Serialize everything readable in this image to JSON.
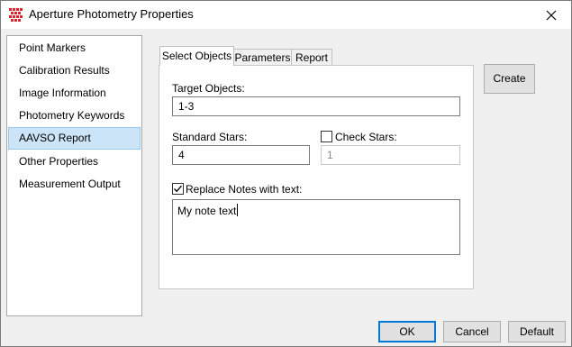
{
  "window": {
    "title": "Aperture Photometry Properties"
  },
  "icons": {
    "app": "grid-app-icon",
    "close": "close-icon",
    "checkmark": "checkmark-icon"
  },
  "colors": {
    "accent": "#0078d7",
    "selection": "#cce4f7",
    "app_icon": "#d9232e"
  },
  "sidebar": {
    "items": [
      {
        "label": "Point Markers"
      },
      {
        "label": "Calibration Results"
      },
      {
        "label": "Image Information"
      },
      {
        "label": "Photometry Keywords"
      },
      {
        "label": "AAVSO Report"
      },
      {
        "label": "Other Properties"
      },
      {
        "label": "Measurement Output"
      }
    ],
    "selected": "AAVSO Report"
  },
  "tabs": [
    {
      "label": "Select Objects"
    },
    {
      "label": "Parameters"
    },
    {
      "label": "Report"
    }
  ],
  "active_tab": "Select Objects",
  "form": {
    "target_label": "Target Objects:",
    "target_value": "1-3",
    "standard_label": "Standard Stars:",
    "standard_value": "4",
    "check_label": "Check Stars:",
    "check_checked": false,
    "check_value": "1",
    "replace_label": "Replace Notes with text:",
    "replace_checked": true,
    "notes_value": "My note text"
  },
  "buttons": {
    "create": "Create",
    "ok": "OK",
    "cancel": "Cancel",
    "default": "Default"
  }
}
